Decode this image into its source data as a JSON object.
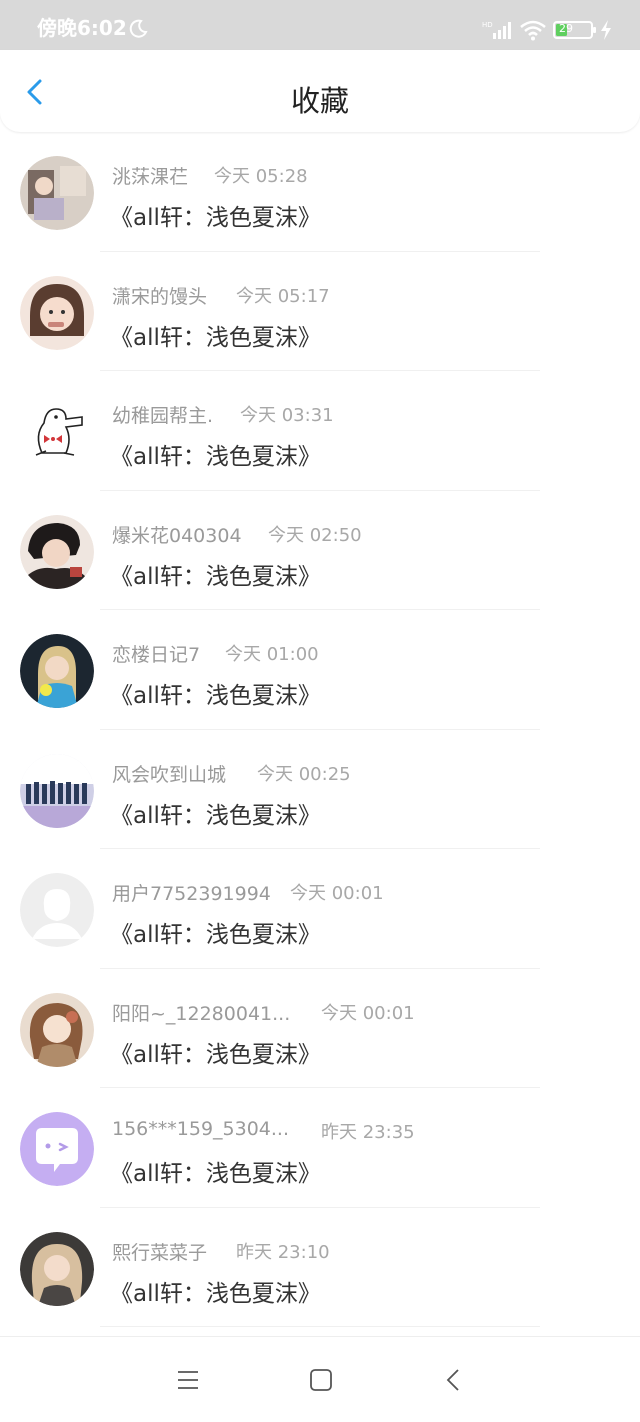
{
  "status_bar": {
    "time": "傍晚6:02",
    "battery": "29",
    "icons": [
      "moon-icon",
      "signal-icon",
      "wifi-icon",
      "battery-icon",
      "charge-icon"
    ]
  },
  "header": {
    "title": "收藏",
    "back_icon": "chevron-left-icon",
    "accent_color": "#2a9bea"
  },
  "items": [
    {
      "name": "洮莯淉芢",
      "time": "今天 05:28",
      "title": "《all轩：浅色夏沫》",
      "avatar": "photo-avatar"
    },
    {
      "name": "潇宋的馒头",
      "time": "今天 05:17",
      "title": "《all轩：浅色夏沫》",
      "avatar": "photo-avatar"
    },
    {
      "name": "幼稚园帮主.",
      "time": "今天 03:31",
      "title": "《all轩：浅色夏沫》",
      "avatar": "goose-sticker-avatar"
    },
    {
      "name": "爆米花040304",
      "time": "今天 02:50",
      "title": "《all轩：浅色夏沫》",
      "avatar": "photo-avatar"
    },
    {
      "name": "恋楼日记7",
      "time": "今天 01:00",
      "title": "《all轩：浅色夏沫》",
      "avatar": "photo-avatar"
    },
    {
      "name": "风会吹到山城",
      "time": "今天 00:25",
      "title": "《all轩：浅色夏沫》",
      "avatar": "photo-avatar"
    },
    {
      "name": "用户7752391994",
      "time": "今天 00:01",
      "title": "《all轩：浅色夏沫》",
      "avatar": "default-user-avatar"
    },
    {
      "name": "阳阳~_12280041...",
      "time": "今天 00:01",
      "title": "《all轩：浅色夏沫》",
      "avatar": "photo-avatar"
    },
    {
      "name": "156***159_5304...",
      "time": "昨天 23:35",
      "title": "《all轩：浅色夏沫》",
      "avatar": "chat-bubble-avatar"
    },
    {
      "name": "熙行菜菜子",
      "time": "昨天 23:10",
      "title": "《all轩：浅色夏沫》",
      "avatar": "photo-avatar"
    }
  ],
  "nav_bar": {
    "icons": [
      "menu-icon",
      "home-icon",
      "back-icon"
    ]
  }
}
